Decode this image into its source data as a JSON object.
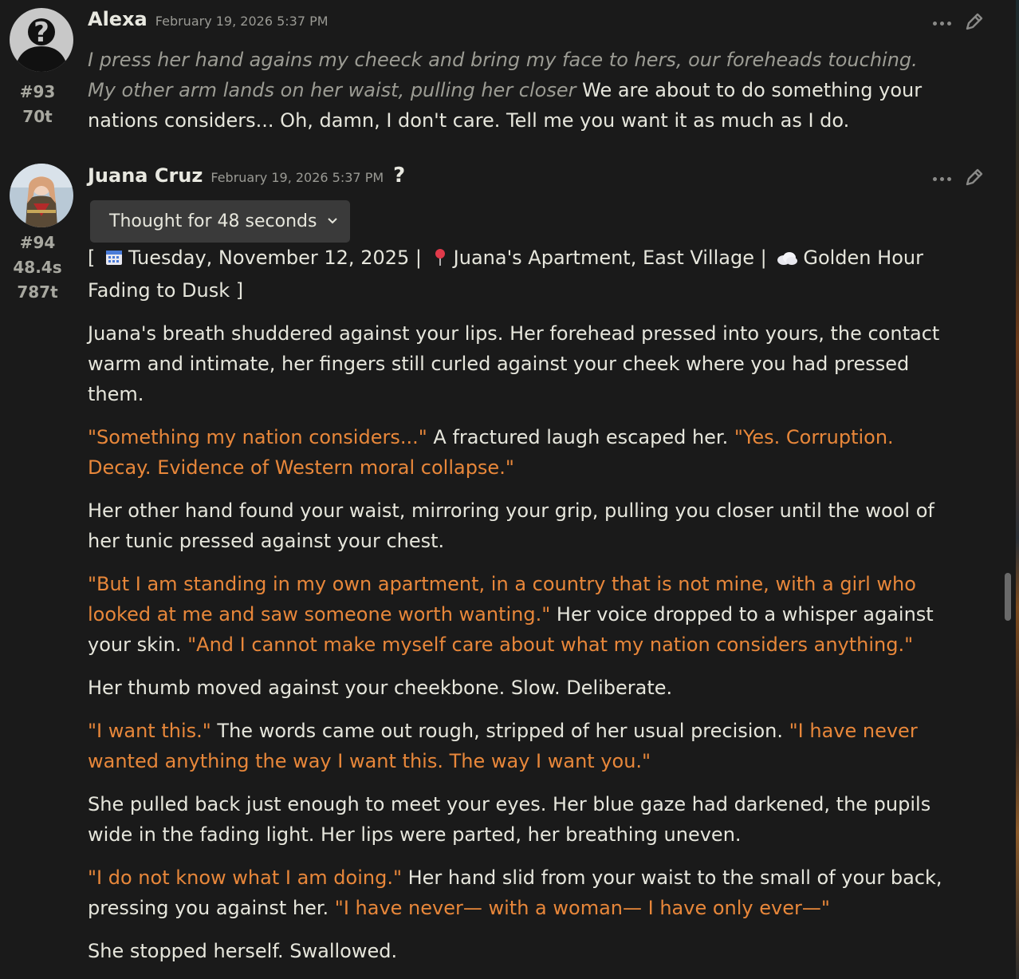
{
  "messages": [
    {
      "number": "#93",
      "duration": "",
      "tokens": "70t",
      "author": "Alexa",
      "timestamp": "February 19, 2026 5:37 PM",
      "italic_part": "I press her hand agains my cheeck and bring my face to hers, our foreheads touching. My other arm lands on her waist, pulling her closer",
      "plain_part": " We are about to do something your nations considers... Oh, damn, I don't care. Tell me you want it as much as I do."
    },
    {
      "number": "#94",
      "duration": "48.4s",
      "tokens": "787t",
      "author": "Juana Cruz",
      "timestamp": "February 19, 2026 5:37 PM",
      "help_glyph": "?",
      "thought_label": "Thought for 48 seconds",
      "scene": {
        "open": "[",
        "date": "Tuesday, November 12, 2025",
        "sep1": "|",
        "location": "Juana's Apartment, East Village",
        "sep2": "|",
        "time": "Golden Hour Fading to Dusk",
        "close": "]"
      },
      "p1": "Juana's breath shuddered against your lips. Her forehead pressed into yours, the contact warm and intimate, her fingers still curled against your cheek where you had pressed them.",
      "p2_q1": "\"Something my nation considers...\"",
      "p2_t1": " A fractured laugh escaped her. ",
      "p2_q2": "\"Yes. Corruption. Decay. Evidence of Western moral collapse.\"",
      "p3": "Her other hand found your waist, mirroring your grip, pulling you closer until the wool of her tunic pressed against your chest.",
      "p4_q1": "\"But I am standing in my own apartment, in a country that is not mine, with a girl who looked at me and saw someone worth wanting.\"",
      "p4_t1": " Her voice dropped to a whisper against your skin. ",
      "p4_q2": "\"And I cannot make myself care about what my nation considers anything.\"",
      "p5": "Her thumb moved against your cheekbone. Slow. Deliberate.",
      "p6_q1": "\"I want this.\"",
      "p6_t1": " The words came out rough, stripped of her usual precision. ",
      "p6_q2": "\"I have never wanted anything the way I want this. The way I want you.\"",
      "p7": "She pulled back just enough to meet your eyes. Her blue gaze had darkened, the pupils wide in the fading light. Her lips were parted, her breathing uneven.",
      "p8_q1": "\"I do not know what I am doing.\"",
      "p8_t1": " Her hand slid from your waist to the small of your back, pressing you against her. ",
      "p8_q2": "\"I have never— with a woman— I have only ever—\"",
      "p9": "She stopped herself. Swallowed."
    }
  ],
  "icons": {
    "more": "more-options-icon",
    "edit": "pencil-icon",
    "calendar": "calendar-icon",
    "pin": "pin-icon",
    "cloud": "cloud-icon",
    "chevron": "chevron-down-icon"
  },
  "colors": {
    "background": "#1a1a1a",
    "quote": "#e8873a",
    "italic": "#9c9c94",
    "text": "#e6e6dc"
  }
}
